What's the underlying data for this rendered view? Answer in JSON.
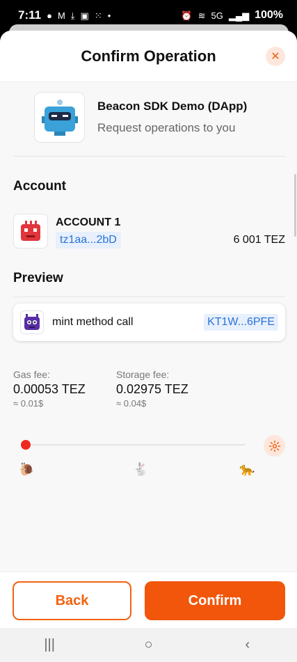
{
  "status": {
    "time": "7:11",
    "left_icons": [
      "account-circle-icon",
      "gmail-icon",
      "download-icon",
      "shopping-bag-icon",
      "apps-icon",
      "dot-icon"
    ],
    "right_icons": [
      "alarm-icon",
      "wifi-icon",
      "5g-icon",
      "signal-icon"
    ],
    "network": "5G",
    "battery": "100%"
  },
  "header": {
    "title": "Confirm Operation",
    "close_icon": "close-icon"
  },
  "dapp": {
    "name": "Beacon SDK Demo (DApp)",
    "subtitle": "Request operations to you"
  },
  "account": {
    "section_title": "Account",
    "name": "ACCOUNT 1",
    "address": "tz1aa...2bD",
    "balance": "6 001 TEZ"
  },
  "preview": {
    "section_title": "Preview",
    "operation_label": "mint method call",
    "contract": "KT1W...6PFE"
  },
  "fees": {
    "gas_label": "Gas fee:",
    "gas_value": "0.00053 TEZ",
    "gas_approx": "≈ 0.01$",
    "storage_label": "Storage fee:",
    "storage_value": "0.02975 TEZ",
    "storage_approx": "≈ 0.04$"
  },
  "speed": {
    "level": 0,
    "icons": [
      "snail-icon",
      "rabbit-icon",
      "cheetah-icon"
    ]
  },
  "footer": {
    "back_label": "Back",
    "confirm_label": "Confirm"
  },
  "colors": {
    "accent": "#f1620f",
    "link": "#2a72d8",
    "slider_thumb": "#ee2a1e"
  },
  "nav": {
    "recents": "|||",
    "home": "○",
    "back": "‹"
  }
}
